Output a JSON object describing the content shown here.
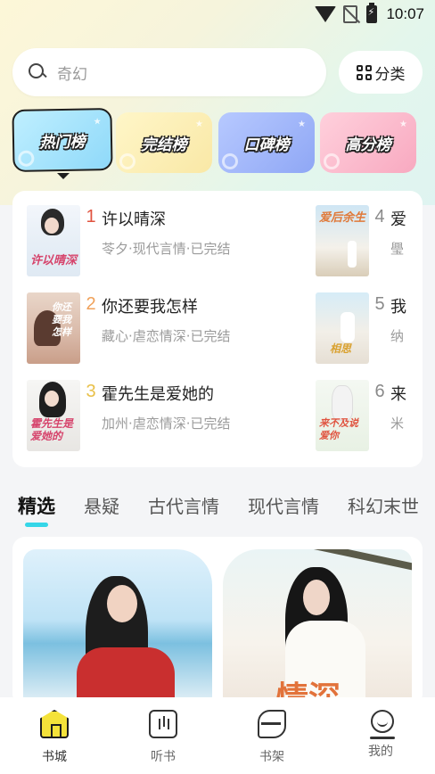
{
  "status_bar": {
    "time": "10:07"
  },
  "search": {
    "placeholder": "奇幻"
  },
  "category_button": {
    "label": "分类"
  },
  "rank_tabs": [
    {
      "label": "热门榜",
      "active": true
    },
    {
      "label": "完结榜",
      "active": false
    },
    {
      "label": "口碑榜",
      "active": false
    },
    {
      "label": "高分榜",
      "active": false
    }
  ],
  "ranking": {
    "items": [
      {
        "rank": "1",
        "title": "许以晴深",
        "meta": "苓夕·现代言情·已完结",
        "cover_text": "许以晴深"
      },
      {
        "rank": "2",
        "title": "你还要我怎样",
        "meta": "藏心·虐恋情深·已完结",
        "cover_text": "你还要我怎样"
      },
      {
        "rank": "3",
        "title": "霍先生是爱她的",
        "meta": "加州·虐恋情深·已完结",
        "cover_text": "霍先生是爱她的"
      },
      {
        "rank": "4",
        "title": "爱",
        "meta": "璺",
        "cover_text": "爱后余生"
      },
      {
        "rank": "5",
        "title": "我",
        "meta": "纳",
        "cover_text": "相思"
      },
      {
        "rank": "6",
        "title": "来",
        "meta": "米",
        "cover_text": "来不及说爱你"
      }
    ]
  },
  "genre_tabs": [
    {
      "label": "精选",
      "active": true
    },
    {
      "label": "悬疑",
      "active": false
    },
    {
      "label": "古代言情",
      "active": false
    },
    {
      "label": "现代言情",
      "active": false
    },
    {
      "label": "科幻末世",
      "active": false
    }
  ],
  "featured": {
    "cover_2_text": "情深"
  },
  "bottom_nav": [
    {
      "label": "书城",
      "icon": "home-icon",
      "active": true
    },
    {
      "label": "听书",
      "icon": "listen-icon",
      "active": false
    },
    {
      "label": "书架",
      "icon": "bookshelf-icon",
      "active": false
    },
    {
      "label": "我的",
      "icon": "profile-icon",
      "active": false
    }
  ],
  "colors": {
    "accent": "#35d6e8",
    "rank_red": "#e0533f",
    "rank_orange": "#f0a15a",
    "rank_gold": "#e9c049",
    "rank_gray": "#8a8a8a"
  }
}
